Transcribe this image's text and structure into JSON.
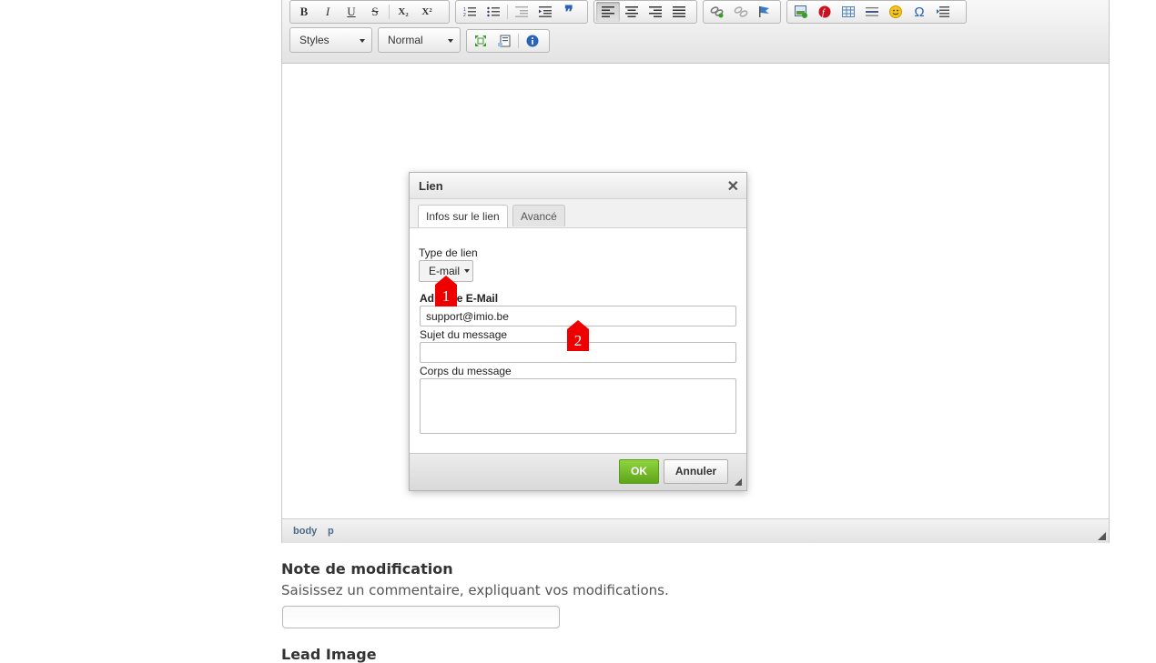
{
  "toolbar": {
    "style_combo": "Styles",
    "format_combo": "Normal",
    "buttons": {
      "bold": "B",
      "italic": "I",
      "underline": "U",
      "strike": "S",
      "subscript": "X₂",
      "superscript": "X²",
      "blockquote": "❞",
      "special_char": "Ω"
    }
  },
  "statusbar": {
    "path": [
      "body",
      "p"
    ]
  },
  "dialog": {
    "title": "Lien",
    "tabs": [
      "Infos sur le lien",
      "Avancé"
    ],
    "link_type_label": "Type de lien",
    "link_type_value": "E-mail",
    "email_label": "Adresse E-Mail",
    "email_value": "support@imio.be",
    "subject_label": "Sujet du message",
    "subject_value": "",
    "body_label": "Corps du message",
    "body_value": "",
    "ok_label": "OK",
    "cancel_label": "Annuler"
  },
  "markers": [
    "1",
    "2"
  ],
  "page": {
    "note_title": "Note de modification",
    "note_help": "Saisissez un commentaire, expliquant vos modifications.",
    "note_value": "",
    "lead_image_title": "Lead Image"
  },
  "colors": {
    "accent_ok": "#6bb522",
    "marker": "#ee0000",
    "path_link": "#4a6a8c"
  }
}
